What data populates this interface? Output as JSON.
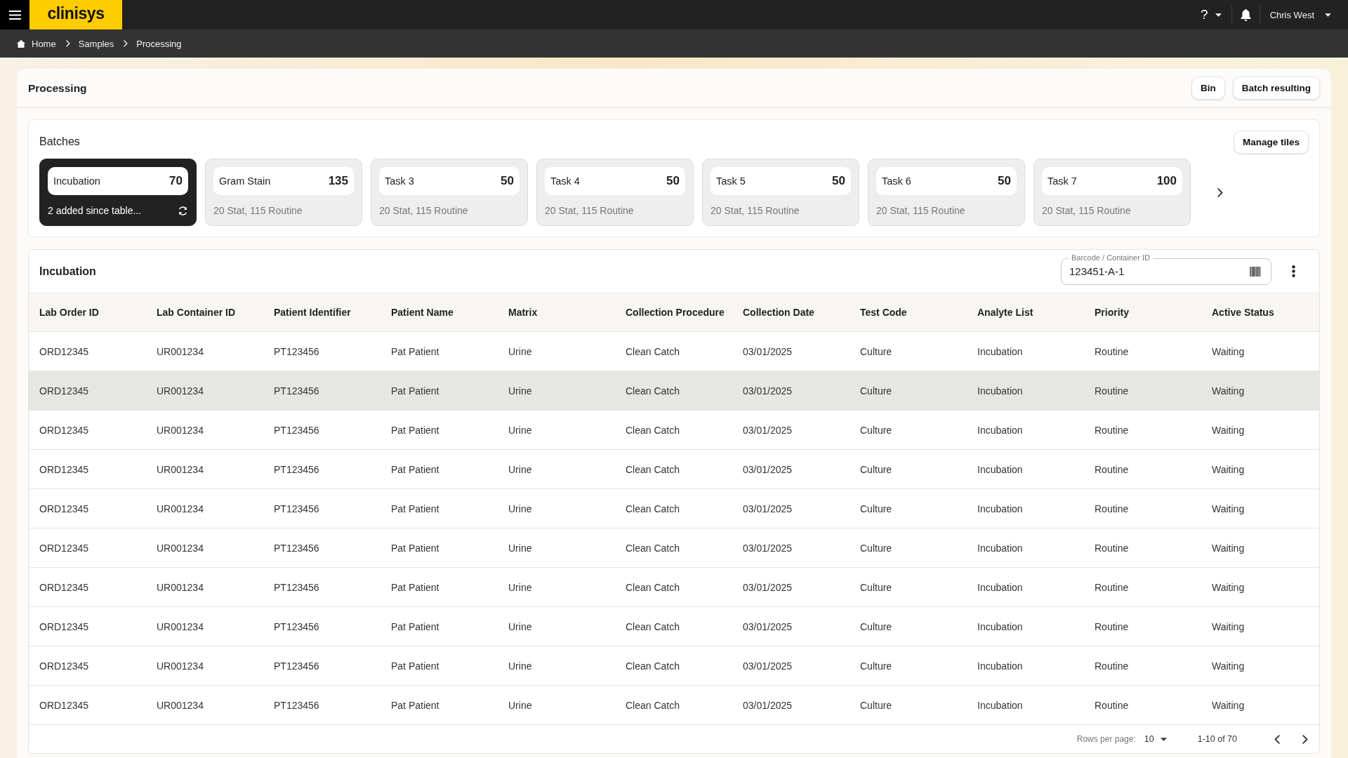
{
  "top_bar": {
    "logo": "clinisys",
    "help_label": "?",
    "user_name": "Chris West"
  },
  "breadcrumb": [
    {
      "kind": "home",
      "label": "Home"
    },
    {
      "kind": "link",
      "label": "Samples"
    },
    {
      "kind": "current",
      "label": "Processing"
    }
  ],
  "page": {
    "title": "Processing",
    "actions": [
      "Bin",
      "Batch resulting"
    ]
  },
  "batches": {
    "title": "Batches",
    "manage_button": "Manage tiles",
    "tiles": [
      {
        "label": "Incubation",
        "count": "70",
        "subtitle": "2 added since table...",
        "selected": true
      },
      {
        "label": "Gram Stain",
        "count": "135",
        "subtitle": "20 Stat, 115 Routine",
        "selected": false
      },
      {
        "label": "Task 3",
        "count": "50",
        "subtitle": "20 Stat, 115 Routine",
        "selected": false
      },
      {
        "label": "Task 4",
        "count": "50",
        "subtitle": "20 Stat, 115 Routine",
        "selected": false
      },
      {
        "label": "Task 5",
        "count": "50",
        "subtitle": "20 Stat, 115 Routine",
        "selected": false
      },
      {
        "label": "Task 6",
        "count": "50",
        "subtitle": "20 Stat, 115 Routine",
        "selected": false
      },
      {
        "label": "Task 7",
        "count": "100",
        "subtitle": "20 Stat, 115 Routine",
        "selected": false
      }
    ]
  },
  "table": {
    "title": "Incubation",
    "barcode_field": {
      "label": "Barcode / Container ID",
      "value": "123451-A-1"
    },
    "columns": [
      "Lab Order ID",
      "Lab Container ID",
      "Patient Identifier",
      "Patient Name",
      "Matrix",
      "Collection Procedure",
      "Collection Date",
      "Test Code",
      "Analyte List",
      "Priority",
      "Active Status"
    ],
    "rows": [
      {
        "selected": false,
        "cells": [
          "ORD12345",
          "UR001234",
          "PT123456",
          "Pat Patient",
          "Urine",
          "Clean Catch",
          "03/01/2025",
          "Culture",
          "Incubation",
          "Routine",
          "Waiting"
        ]
      },
      {
        "selected": true,
        "cells": [
          "ORD12345",
          "UR001234",
          "PT123456",
          "Pat Patient",
          "Urine",
          "Clean Catch",
          "03/01/2025",
          "Culture",
          "Incubation",
          "Routine",
          "Waiting"
        ]
      },
      {
        "selected": false,
        "cells": [
          "ORD12345",
          "UR001234",
          "PT123456",
          "Pat Patient",
          "Urine",
          "Clean Catch",
          "03/01/2025",
          "Culture",
          "Incubation",
          "Routine",
          "Waiting"
        ]
      },
      {
        "selected": false,
        "cells": [
          "ORD12345",
          "UR001234",
          "PT123456",
          "Pat Patient",
          "Urine",
          "Clean Catch",
          "03/01/2025",
          "Culture",
          "Incubation",
          "Routine",
          "Waiting"
        ]
      },
      {
        "selected": false,
        "cells": [
          "ORD12345",
          "UR001234",
          "PT123456",
          "Pat Patient",
          "Urine",
          "Clean Catch",
          "03/01/2025",
          "Culture",
          "Incubation",
          "Routine",
          "Waiting"
        ]
      },
      {
        "selected": false,
        "cells": [
          "ORD12345",
          "UR001234",
          "PT123456",
          "Pat Patient",
          "Urine",
          "Clean Catch",
          "03/01/2025",
          "Culture",
          "Incubation",
          "Routine",
          "Waiting"
        ]
      },
      {
        "selected": false,
        "cells": [
          "ORD12345",
          "UR001234",
          "PT123456",
          "Pat Patient",
          "Urine",
          "Clean Catch",
          "03/01/2025",
          "Culture",
          "Incubation",
          "Routine",
          "Waiting"
        ]
      },
      {
        "selected": false,
        "cells": [
          "ORD12345",
          "UR001234",
          "PT123456",
          "Pat Patient",
          "Urine",
          "Clean Catch",
          "03/01/2025",
          "Culture",
          "Incubation",
          "Routine",
          "Waiting"
        ]
      },
      {
        "selected": false,
        "cells": [
          "ORD12345",
          "UR001234",
          "PT123456",
          "Pat Patient",
          "Urine",
          "Clean Catch",
          "03/01/2025",
          "Culture",
          "Incubation",
          "Routine",
          "Waiting"
        ]
      },
      {
        "selected": false,
        "cells": [
          "ORD12345",
          "UR001234",
          "PT123456",
          "Pat Patient",
          "Urine",
          "Clean Catch",
          "03/01/2025",
          "Culture",
          "Incubation",
          "Routine",
          "Waiting"
        ]
      }
    ]
  },
  "pagination": {
    "rows_per_page_label": "Rows per page:",
    "rows_per_page": "10",
    "range": "1-10 of 70"
  }
}
